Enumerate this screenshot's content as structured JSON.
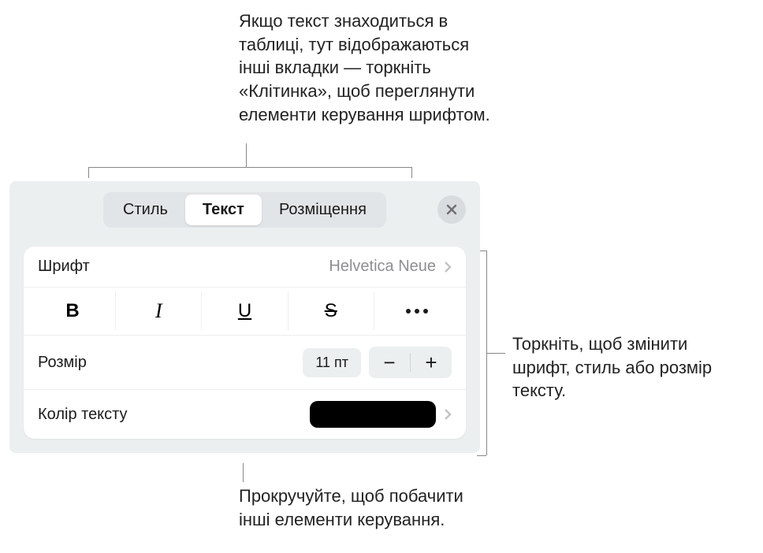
{
  "callouts": {
    "top": "Якщо текст знаходиться в таблиці, тут відображаються інші вкладки — торкніть «Клітинка», щоб переглянути елементи керування шрифтом.",
    "right": "Торкніть, щоб змінити шрифт, стиль або розмір тексту.",
    "bottom": "Прокручуйте, щоб побачити інші елементи керування."
  },
  "tabs": {
    "style": "Стиль",
    "text": "Текст",
    "layout": "Розміщення"
  },
  "font_row": {
    "label": "Шрифт",
    "value": "Helvetica Neue"
  },
  "style_buttons": {
    "bold": "B",
    "italic": "I",
    "underline": "U",
    "strike": "S"
  },
  "size_row": {
    "label": "Розмір",
    "value": "11 пт",
    "minus": "−",
    "plus": "+"
  },
  "color_row": {
    "label": "Колір тексту",
    "swatch": "#000000"
  }
}
